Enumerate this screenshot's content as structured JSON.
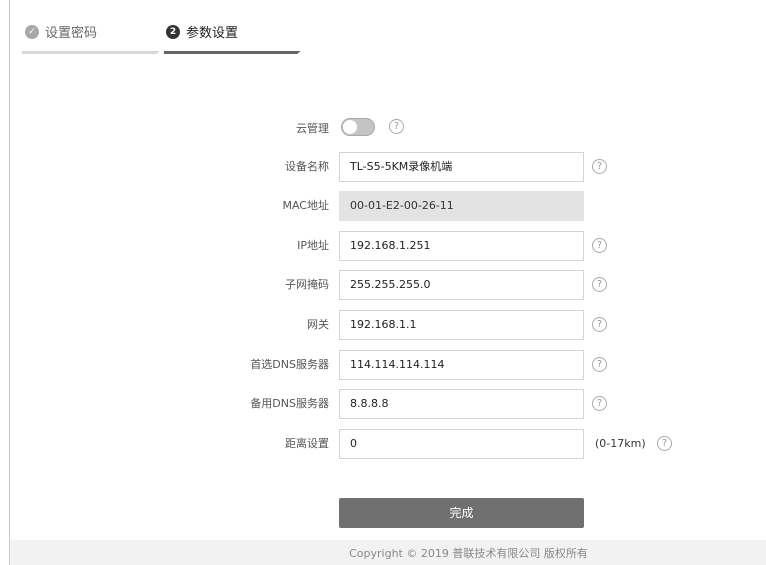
{
  "steps": [
    {
      "label": "设置密码",
      "marker": "✓"
    },
    {
      "label": "参数设置",
      "marker": "2"
    }
  ],
  "form": {
    "cloud": {
      "label": "云管理",
      "enabled": false
    },
    "device_name": {
      "label": "设备名称",
      "value": "TL-S5-5KM录像机端"
    },
    "mac": {
      "label": "MAC地址",
      "value": "00-01-E2-00-26-11"
    },
    "ip": {
      "label": "IP地址",
      "value": "192.168.1.251"
    },
    "subnet": {
      "label": "子网掩码",
      "value": "255.255.255.0"
    },
    "gateway": {
      "label": "网关",
      "value": "192.168.1.1"
    },
    "dns1": {
      "label": "首选DNS服务器",
      "value": "114.114.114.114"
    },
    "dns2": {
      "label": "备用DNS服务器",
      "value": "8.8.8.8"
    },
    "distance": {
      "label": "距离设置",
      "value": "0",
      "unit": "(0-17km)"
    }
  },
  "help_glyph": "?",
  "submit_label": "完成",
  "footer": "Copyright © 2019 普联技术有限公司 版权所有",
  "colors": {
    "button": "#707070",
    "active_step_bar": "#666666",
    "inactive_step_bar": "#d7d7d7",
    "readonly_field": "#e3e3e3"
  }
}
